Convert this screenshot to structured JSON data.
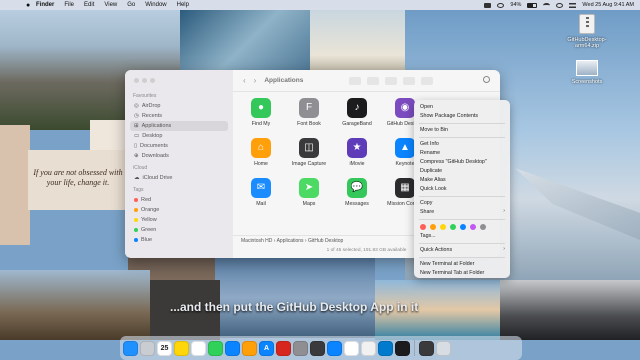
{
  "menubar": {
    "apple": "",
    "items": [
      "Finder",
      "File",
      "Edit",
      "View",
      "Go",
      "Window",
      "Help"
    ],
    "battery": "94%",
    "clock": "Wed 25 Aug  9:41 AM"
  },
  "desktop": {
    "files": [
      {
        "label": "GitHubDesktop-arm64.zip",
        "icon": "zip-file-icon"
      },
      {
        "label": "Screenshots",
        "icon": "screenshot-folder-icon"
      }
    ],
    "quote": "If you are not obsessed with your life, change it.",
    "subtitle": "...and then put the GitHub Desktop App in it"
  },
  "finder": {
    "title": "Applications",
    "sidebar": {
      "favourites_header": "Favourites",
      "favourites": [
        "AirDrop",
        "Recents",
        "Applications",
        "Desktop",
        "Documents",
        "Downloads"
      ],
      "icloud_header": "iCloud",
      "icloud": [
        "iCloud Drive"
      ],
      "tags_header": "Tags",
      "tags": [
        {
          "label": "Red",
          "color": "#ff5f57"
        },
        {
          "label": "Orange",
          "color": "#ff9f0a"
        },
        {
          "label": "Yellow",
          "color": "#ffd60a"
        },
        {
          "label": "Green",
          "color": "#30d158"
        },
        {
          "label": "Blue",
          "color": "#0a84ff"
        }
      ]
    },
    "apps": [
      {
        "label": "Find My",
        "color": "#34c759",
        "glyph": "●"
      },
      {
        "label": "Font Book",
        "color": "#8e8e93",
        "glyph": "F"
      },
      {
        "label": "GarageBand",
        "color": "#1c1c1e",
        "glyph": "♪"
      },
      {
        "label": "GitHub Desktop",
        "color": "#7b4bbf",
        "glyph": "◉"
      },
      {
        "label": "Home",
        "color": "#ff9f0a",
        "glyph": "⌂"
      },
      {
        "label": "Image Capture",
        "color": "#3a3a3c",
        "glyph": "◫"
      },
      {
        "label": "iMovie",
        "color": "#5e3bb8",
        "glyph": "★"
      },
      {
        "label": "Keynote",
        "color": "#0a84ff",
        "glyph": "▲"
      },
      {
        "label": "Mail",
        "color": "#1a8cff",
        "glyph": "✉"
      },
      {
        "label": "Maps",
        "color": "#4cd964",
        "glyph": "➤"
      },
      {
        "label": "Messages",
        "color": "#34c759",
        "glyph": "💬"
      },
      {
        "label": "Mission Control",
        "color": "#2c2c2e",
        "glyph": "▦"
      }
    ],
    "pathbar": [
      "Macintosh HD",
      "Applications",
      "GitHub Desktop"
    ],
    "status": "1 of 45 selected, 191.83 GB available"
  },
  "context_menu": {
    "group1": [
      "Open",
      "Show Package Contents"
    ],
    "group2": [
      "Move to Bin"
    ],
    "group3": [
      "Get Info",
      "Rename",
      "Compress \"GitHub Desktop\"",
      "Duplicate",
      "Make Alias",
      "Quick Look"
    ],
    "group4": [
      "Copy",
      "Share"
    ],
    "tag_colors": [
      "#ff5f57",
      "#ff9f0a",
      "#ffd60a",
      "#30d158",
      "#0a84ff",
      "#bf5af2",
      "#8e8e93"
    ],
    "tags_label": "Tags...",
    "quick_actions": "Quick Actions",
    "group6": [
      "New Terminal at Folder",
      "New Terminal Tab at Folder"
    ]
  },
  "dock": {
    "apps": [
      {
        "name": "finder",
        "color": "#1e90ff"
      },
      {
        "name": "launchpad",
        "color": "#c9ccd1"
      },
      {
        "name": "calendar",
        "color": "#ffffff",
        "text": "25"
      },
      {
        "name": "notes",
        "color": "#ffd60a"
      },
      {
        "name": "reminders",
        "color": "#ffffff"
      },
      {
        "name": "numbers",
        "color": "#30d158"
      },
      {
        "name": "keynote",
        "color": "#0a84ff"
      },
      {
        "name": "pages",
        "color": "#ff9f0a"
      },
      {
        "name": "app-store",
        "color": "#0a84ff",
        "text": "A"
      },
      {
        "name": "acrobat",
        "color": "#d7261e"
      },
      {
        "name": "system-preferences",
        "color": "#8e8e93"
      },
      {
        "name": "quicktime",
        "color": "#3a3a3c"
      },
      {
        "name": "safari",
        "color": "#0a84ff"
      },
      {
        "name": "photos",
        "color": "#ffffff"
      },
      {
        "name": "chrome",
        "color": "#f1f1f1"
      },
      {
        "name": "vscode",
        "color": "#007acc"
      },
      {
        "name": "terminal",
        "color": "#1c1c1e"
      },
      {
        "name": "screenshots-folder",
        "color": "#3a3a3c"
      },
      {
        "name": "trash",
        "color": "#d8dde3"
      }
    ]
  }
}
